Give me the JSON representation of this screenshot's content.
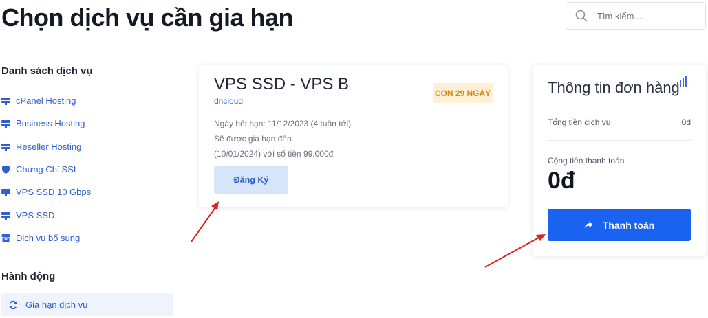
{
  "header": {
    "title": "Chọn dịch vụ cần gia hạn",
    "search_placeholder": "Tìm kiếm ..."
  },
  "sidebar": {
    "services_heading": "Danh sách dịch vụ",
    "items": [
      {
        "label": "cPanel Hosting",
        "icon": "server-icon"
      },
      {
        "label": "Business Hosting",
        "icon": "server-icon"
      },
      {
        "label": "Reseller Hosting",
        "icon": "server-icon"
      },
      {
        "label": "Chứng Chỉ SSL",
        "icon": "shield-icon"
      },
      {
        "label": "VPS SSD 10 Gbps",
        "icon": "server-icon"
      },
      {
        "label": "VPS SSD",
        "icon": "server-icon"
      },
      {
        "label": "Dịch vụ bổ sung",
        "icon": "box-icon"
      }
    ],
    "actions_heading": "Hành động",
    "actions": [
      {
        "label": "Gia hạn dịch vụ",
        "icon": "refresh-icon"
      }
    ]
  },
  "service_card": {
    "name": "VPS SSD - VPS B",
    "host": "dncloud",
    "badge": "CÒN 29 NGÀY",
    "expiry": "Ngày hết hạn: 11/12/2023 (4 tuần tới)",
    "renew_line": "Sẽ được gia hạn đến",
    "renew_detail": "(10/01/2024) với số tiền 99,000đ",
    "register_label": "Đăng Ký"
  },
  "order": {
    "title": "Thông tin đơn hàng",
    "subtotal_label": "Tổng tiền dịch vụ",
    "subtotal_value": "0đ",
    "total_label": "Cộng tiền thanh toán",
    "total_value": "0đ",
    "pay_label": "Thanh toán"
  },
  "colors": {
    "accent": "#1a63f0",
    "link": "#2f5fd0",
    "badge_bg": "#fdf0d6",
    "badge_text": "#d98a12",
    "annotation_arrow": "#e0201b"
  }
}
